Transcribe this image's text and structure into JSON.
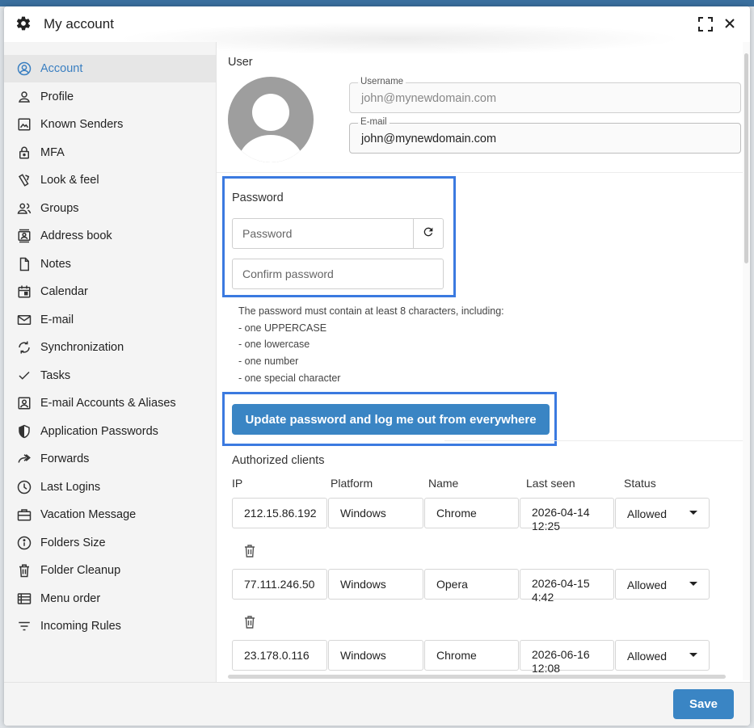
{
  "dialog": {
    "title": "My account",
    "title_icon": "gear-icon",
    "maximize_icon": "maximize-icon",
    "close_icon": "close-icon"
  },
  "sidebar": {
    "items": [
      {
        "label": "Account",
        "icon": "account-circle-icon",
        "active": true
      },
      {
        "label": "Profile",
        "icon": "person-icon"
      },
      {
        "label": "Known Senders",
        "icon": "image-icon"
      },
      {
        "label": "MFA",
        "icon": "lock-icon"
      },
      {
        "label": "Look & feel",
        "icon": "palette-icon"
      },
      {
        "label": "Groups",
        "icon": "groups-icon"
      },
      {
        "label": "Address book",
        "icon": "contacts-icon"
      },
      {
        "label": "Notes",
        "icon": "note-icon"
      },
      {
        "label": "Calendar",
        "icon": "calendar-icon"
      },
      {
        "label": "E-mail",
        "icon": "mail-icon"
      },
      {
        "label": "Synchronization",
        "icon": "sync-icon"
      },
      {
        "label": "Tasks",
        "icon": "check-icon"
      },
      {
        "label": "E-mail Accounts & Aliases",
        "icon": "account-box-icon"
      },
      {
        "label": "Application Passwords",
        "icon": "shield-icon"
      },
      {
        "label": "Forwards",
        "icon": "forward-icon"
      },
      {
        "label": "Last Logins",
        "icon": "clock-icon"
      },
      {
        "label": "Vacation Message",
        "icon": "briefcase-icon"
      },
      {
        "label": "Folders Size",
        "icon": "info-icon"
      },
      {
        "label": "Folder Cleanup",
        "icon": "trash-icon"
      },
      {
        "label": "Menu order",
        "icon": "list-icon"
      },
      {
        "label": "Incoming Rules",
        "icon": "filter-icon"
      }
    ]
  },
  "user": {
    "section_label": "User",
    "username_label": "Username",
    "username_value": "john@mynewdomain.com",
    "email_label": "E-mail",
    "email_value": "john@mynewdomain.com"
  },
  "password": {
    "section_label": "Password",
    "password_placeholder": "Password",
    "confirm_placeholder": "Confirm password",
    "rules": [
      "The password must contain at least 8 characters, including:",
      "- one UPPERCASE",
      "- one lowercase",
      "- one number",
      "- one special character"
    ],
    "update_button": "Update password and log me out from everywhere"
  },
  "clients": {
    "section_label": "Authorized clients",
    "columns": [
      "IP",
      "Platform",
      "Name",
      "Last seen",
      "Status"
    ],
    "rows": [
      {
        "ip": "212.15.86.192",
        "platform": "Windows",
        "name": "Chrome",
        "last_seen_date": "2026-04-14",
        "last_seen_time": "12:25",
        "status": "Allowed"
      },
      {
        "ip": "77.111.246.50",
        "platform": "Windows",
        "name": "Opera",
        "last_seen_date": "2026-04-15",
        "last_seen_time": "4:42",
        "status": "Allowed"
      },
      {
        "ip": "23.178.0.116",
        "platform": "Windows",
        "name": "Chrome",
        "last_seen_date": "2026-06-16",
        "last_seen_time": "12:08",
        "status": "Allowed"
      }
    ]
  },
  "footer": {
    "save_label": "Save"
  },
  "colors": {
    "accent": "#3a85c4",
    "highlight": "#3b7ae0",
    "active_nav_text": "#3a7fc1"
  }
}
